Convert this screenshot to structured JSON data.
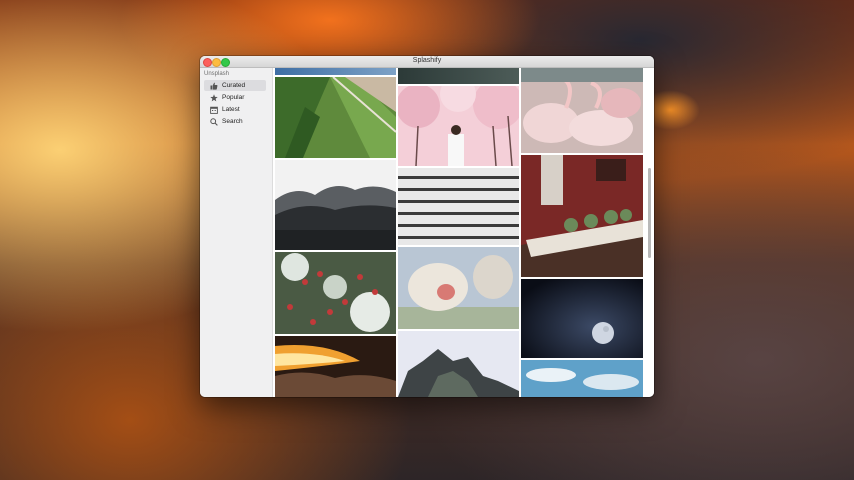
{
  "window": {
    "title": "Splashify"
  },
  "sidebar": {
    "section_header": "Unsplash",
    "items": [
      {
        "label": "Curated",
        "icon": "thumbs-up-icon",
        "selected": true
      },
      {
        "label": "Popular",
        "icon": "star-icon",
        "selected": false
      },
      {
        "label": "Latest",
        "icon": "calendar-icon",
        "selected": false
      },
      {
        "label": "Search",
        "icon": "search-icon",
        "selected": false
      }
    ]
  },
  "photos": [
    "aerial-fields",
    "misty-forest",
    "red-berries-snow",
    "sunset-over-clouds",
    "dark-fern",
    "pink-cherry-blossom-woman",
    "white-slatted-wall",
    "snow-monkey",
    "misty-mountain-peaks",
    "flamingos",
    "dining-room-table",
    "moon-night-sky",
    "blue-sky-clouds"
  ],
  "colors": {
    "selection": "#dcdcdf",
    "close": "#fc605c",
    "minimize": "#fdbc40",
    "maximize": "#34c84a"
  }
}
